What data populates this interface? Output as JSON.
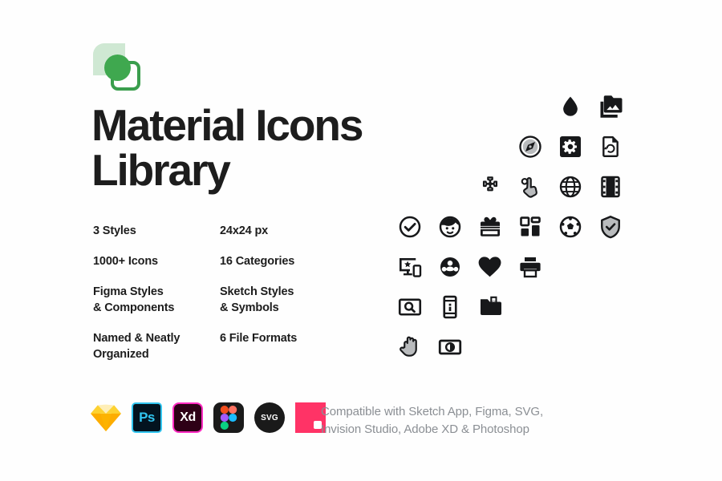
{
  "poster": {
    "background_color": "#fefefe",
    "title_lines": [
      "Material Icons",
      "Library"
    ],
    "brand_green": "#3fa84f",
    "brand_green_light": "#cfe8d3",
    "brand_green_outline": "#3a9e4d"
  },
  "logo": {
    "name": "material-icons-library-logo",
    "leaf_color": "#cfe8d3",
    "circle_color": "#3fa84f",
    "square_outline_color": "#3a9e4d"
  },
  "features": [
    {
      "lines": [
        "3 Styles"
      ]
    },
    {
      "lines": [
        "24x24 px"
      ]
    },
    {
      "lines": [
        "1000+ Icons"
      ]
    },
    {
      "lines": [
        "16 Categories"
      ]
    },
    {
      "lines": [
        "Figma Styles",
        "& Components"
      ]
    },
    {
      "lines": [
        "Sketch Styles",
        "& Symbols"
      ]
    },
    {
      "lines": [
        "Named & Neatly",
        "Organized"
      ]
    },
    {
      "lines": [
        "6 File Formats"
      ]
    }
  ],
  "icon_grid": {
    "columns": 6,
    "rows": [
      {
        "cells": [
          "",
          "",
          "",
          "",
          "opacity-icon",
          "photo-library-icon"
        ]
      },
      {
        "cells": [
          "",
          "",
          "",
          "explore-compass-icon",
          "settings-gear-icon",
          "restore-page-icon"
        ]
      },
      {
        "cells": [
          "",
          "",
          "extension-puzzle-icon",
          "touch-app-icon",
          "language-globe-icon",
          "movie-filmstrip-icon"
        ]
      },
      {
        "cells": [
          "check-circle-icon",
          "face-icon",
          "card-giftcard-icon",
          "dashboard-icon",
          "sports-soccer-icon",
          "verified-user-icon"
        ]
      },
      {
        "cells": [
          "devices-star-icon",
          "group-people-icon",
          "favorite-heart-icon",
          "print-icon",
          "",
          ""
        ]
      },
      {
        "cells": [
          "image-search-icon",
          "perm-device-info-icon",
          "folder-special-icon",
          "",
          "",
          ""
        ]
      },
      {
        "cells": [
          "pan-tool-hand-icon",
          "brightness-contrast-icon",
          "",
          "",
          "",
          ""
        ]
      }
    ],
    "icon_color_dark": "#17181a",
    "icon_color_mid": "#b9bbbd"
  },
  "app_logos": [
    {
      "name": "sketch-logo",
      "label": "",
      "color": "#fdad00"
    },
    {
      "name": "photoshop-logo",
      "label": "Ps",
      "color": "#31c5f0"
    },
    {
      "name": "adobe-xd-logo",
      "label": "Xd",
      "color": "#ff2bc2"
    },
    {
      "name": "figma-logo",
      "label": "",
      "color": "#1a1a1a"
    },
    {
      "name": "svg-logo",
      "label": "SVG",
      "color": "#1a1a1a"
    },
    {
      "name": "invision-logo",
      "label": "",
      "color": "#ff3366"
    }
  ],
  "compatibility": {
    "lines": [
      "Compatible with Sketch App, Figma, SVG,",
      "Invision Studio, Adobe XD & Photoshop"
    ],
    "text_color": "#8b8f94"
  }
}
